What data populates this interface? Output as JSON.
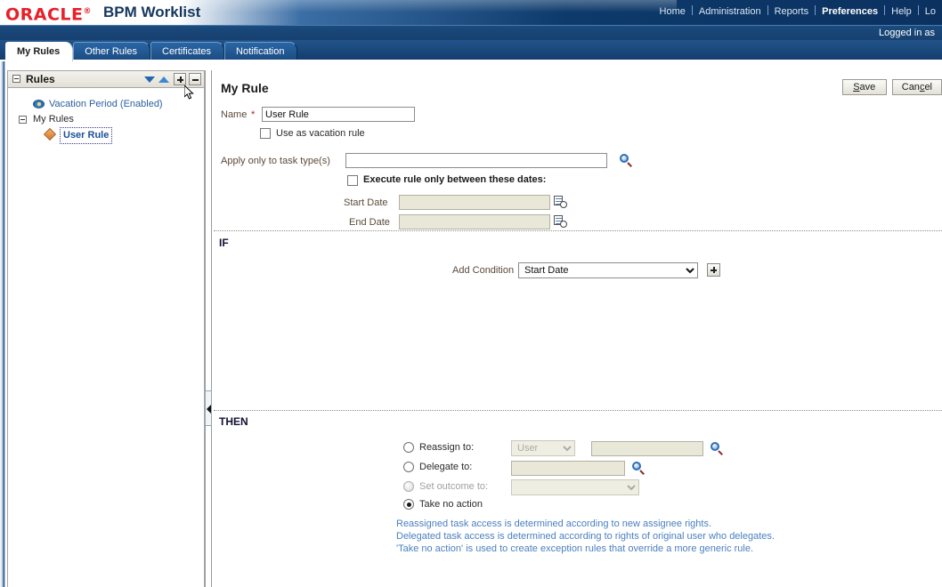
{
  "brand": {
    "logo_text": "ORACLE",
    "logo_mark": "®",
    "app_title": "BPM Worklist"
  },
  "topnav": {
    "items": [
      {
        "label": "Home",
        "current": false
      },
      {
        "label": "Administration",
        "current": false
      },
      {
        "label": "Reports",
        "current": false
      },
      {
        "label": "Preferences",
        "current": true
      },
      {
        "label": "Help",
        "current": false
      },
      {
        "label": "Lo",
        "current": false
      }
    ],
    "logged_in_as": "Logged in as"
  },
  "tabs": [
    {
      "label": "My Rules",
      "active": true
    },
    {
      "label": "Other Rules",
      "active": false
    },
    {
      "label": "Certificates",
      "active": false
    },
    {
      "label": "Notification",
      "active": false
    }
  ],
  "sidebar": {
    "title": "Rules",
    "tree": [
      {
        "label": "Vacation Period (Enabled)",
        "type": "vacation"
      },
      {
        "label": "My Rules",
        "type": "folder"
      },
      {
        "label": "User Rule",
        "type": "rule",
        "selected": true
      }
    ],
    "icons": {
      "collapse": "minus-box-icon",
      "sort_down": "sort-down-icon",
      "sort_up": "sort-up-icon",
      "add": "add-rule-button",
      "remove": "remove-rule-button"
    }
  },
  "main": {
    "page_title": "My Rule",
    "buttons": {
      "save": "Save",
      "cancel": "Cancel"
    },
    "name_label": "Name",
    "name_required": "*",
    "name_value": "User Rule",
    "vacation_checkbox_label": "Use as vacation rule",
    "vacation_checked": false,
    "task_type_label": "Apply only to task type(s)",
    "task_type_value": "",
    "execute_between_label": "Execute rule only between these dates:",
    "execute_between_checked": false,
    "start_date_label": "Start Date",
    "start_date_value": "",
    "end_date_label": "End Date",
    "end_date_value": "",
    "if_label": "IF",
    "add_condition_label": "Add Condition",
    "add_condition_value": "Start Date",
    "add_condition_options": [
      "Start Date"
    ],
    "then_label": "THEN",
    "actions": [
      {
        "label": "Reassign to:",
        "selected": false,
        "disabled": false
      },
      {
        "label": "Delegate to:",
        "selected": false,
        "disabled": false
      },
      {
        "label": "Set outcome to:",
        "selected": false,
        "disabled": true
      },
      {
        "label": "Take no action",
        "selected": true,
        "disabled": false
      }
    ],
    "reassign_type_value": "User",
    "reassign_type_options": [
      "User"
    ],
    "reassign_value": "",
    "delegate_value": "",
    "outcome_value": "",
    "help_lines": [
      "Reassigned task access is determined according to new assignee rights.",
      "Delegated task access is determined according to rights of original user who delegates.",
      "'Take no action' is used to create exception rules that override a more generic rule."
    ]
  }
}
